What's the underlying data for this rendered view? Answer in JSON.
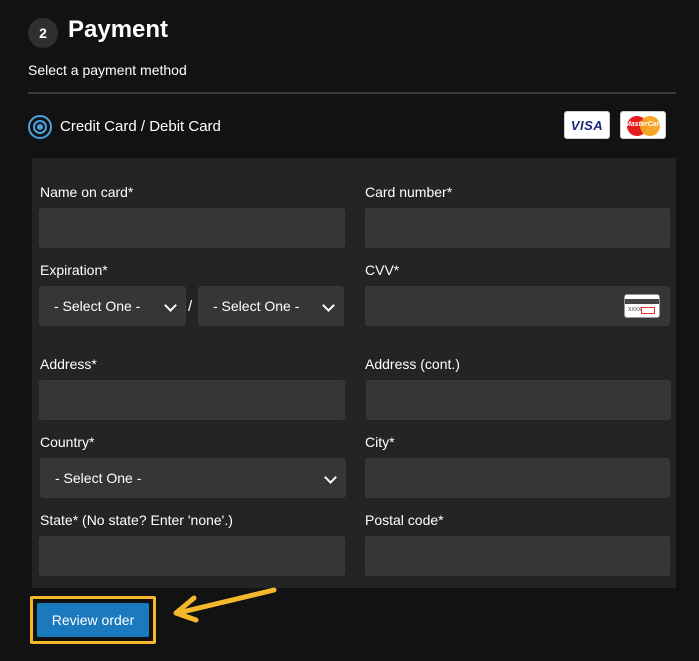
{
  "section": {
    "step_number": "2",
    "title": "Payment",
    "subtitle": "Select a payment method"
  },
  "payment_method": {
    "label": "Credit Card / Debit Card",
    "selected": true,
    "card_logos": [
      "visa-logo",
      "mastercard-logo"
    ],
    "visa_text": "VISA",
    "mastercard_text": "MasterCard"
  },
  "form": {
    "name_label": "Name on card*",
    "card_number_label": "Card number*",
    "expiration_label": "Expiration*",
    "exp_month_value": "- Select One -",
    "exp_separator": "/",
    "exp_year_value": "- Select One -",
    "cvv_label": "CVV*",
    "cvv_icon_text": "XXXX",
    "address_label": "Address*",
    "address2_label": "Address (cont.)",
    "country_label": "Country*",
    "country_value": "- Select One -",
    "city_label": "City*",
    "state_label": "State* (No state? Enter 'none'.)",
    "postal_label": "Postal code*"
  },
  "actions": {
    "review_label": "Review order"
  },
  "colors": {
    "background": "#121212",
    "panel": "#242424",
    "field": "#363636",
    "accent_blue": "#1b79bd",
    "highlight": "#f6b82b"
  }
}
